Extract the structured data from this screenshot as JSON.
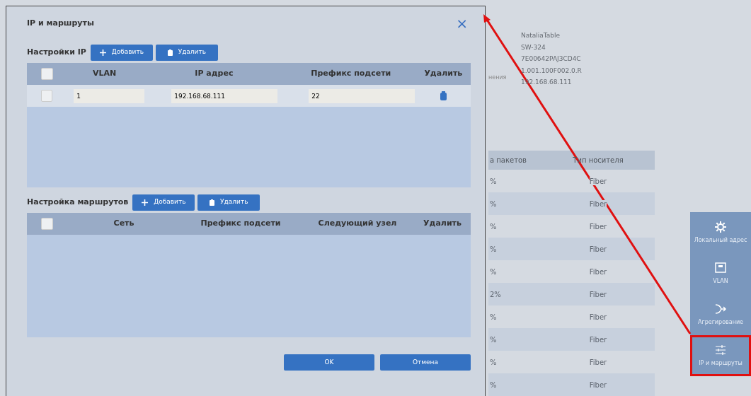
{
  "background": {
    "info_label": "нения",
    "info_values": [
      "NataliaTable",
      "SW-324",
      "7E00642PAJ3CD4C",
      "1.001.100F002.0.R",
      "192.168.68.111"
    ],
    "table": {
      "columns": [
        "а пакетов",
        "Тип носителя"
      ],
      "rows": [
        [
          "%",
          "Fiber"
        ],
        [
          "%",
          "Fiber"
        ],
        [
          "%",
          "Fiber"
        ],
        [
          "%",
          "Fiber"
        ],
        [
          "%",
          "Fiber"
        ],
        [
          "2%",
          "Fiber"
        ],
        [
          "%",
          "Fiber"
        ],
        [
          "%",
          "Fiber"
        ],
        [
          "%",
          "Fiber"
        ],
        [
          "%",
          "Fiber"
        ]
      ]
    },
    "side_menu": [
      {
        "label": "Локальный адрес",
        "kind": "gear",
        "selected": false
      },
      {
        "label": "VLAN",
        "kind": "port",
        "selected": false
      },
      {
        "label": "Агрегирование",
        "kind": "merge",
        "selected": false
      },
      {
        "label": "IP и маршруты",
        "kind": "sliders",
        "selected": true
      }
    ]
  },
  "dialog": {
    "title": "IP и маршруты",
    "close": "×",
    "ip_section": {
      "label": "Настройки IP",
      "buttons": [
        {
          "label": "Добавить",
          "kind": "add"
        },
        {
          "label": "Удалить",
          "kind": "delete"
        }
      ],
      "columns": [
        "VLAN",
        "IP адрес",
        "Префикс подсети",
        "Удалить"
      ],
      "header_checked": false,
      "rows": [
        {
          "checked": false,
          "vlan": "1",
          "ip": "192.168.68.111",
          "prefix": "22"
        }
      ]
    },
    "route_section": {
      "label": "Настройка маршрутов",
      "buttons": [
        {
          "label": "Добавить",
          "kind": "add"
        },
        {
          "label": "Удалить",
          "kind": "delete"
        }
      ],
      "columns": [
        "Сеть",
        "Префикс подсети",
        "Следующий узел",
        "Удалить"
      ],
      "header_checked": false
    },
    "footer_buttons": [
      "OK",
      "Отмена"
    ]
  }
}
